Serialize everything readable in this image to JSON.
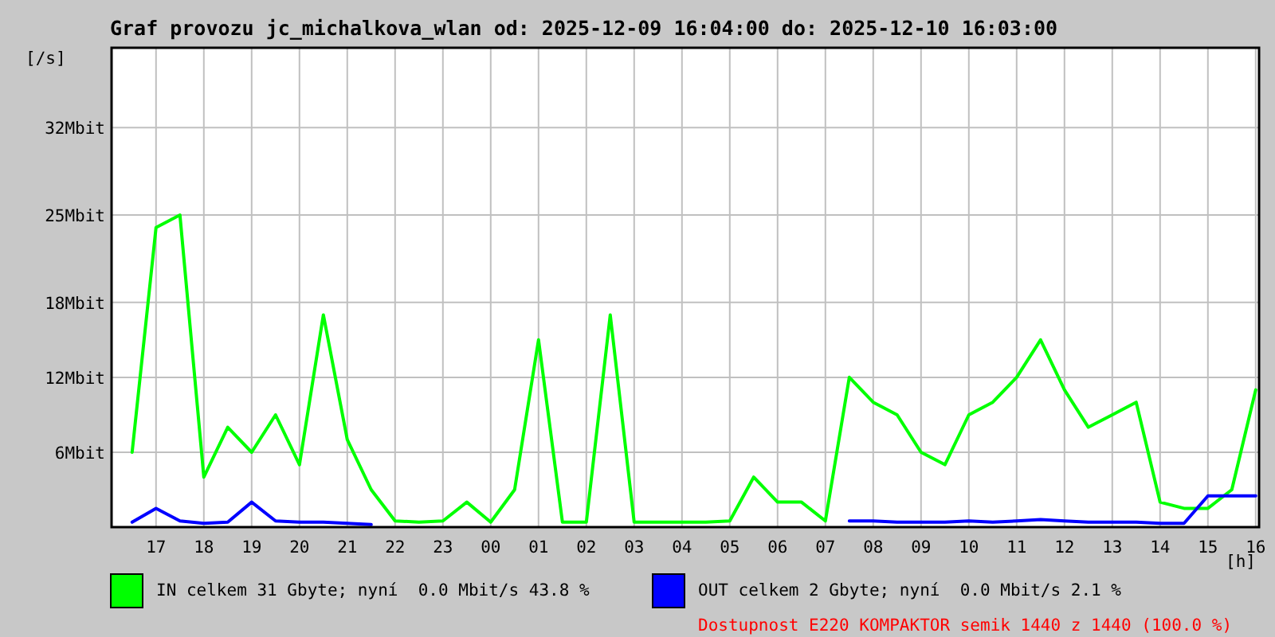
{
  "title": "Graf provozu jc_michalkova_wlan od: 2025-12-09 16:04:00 do: 2025-12-10 16:03:00",
  "chart_data": {
    "type": "line",
    "xlabel": "[h]",
    "grid": true,
    "ylabel": "[/s]",
    "ylim": [
      0,
      38.4
    ],
    "categories": [
      null,
      "17",
      null,
      "18",
      null,
      "19",
      null,
      "20",
      null,
      "21",
      null,
      "22",
      null,
      "23",
      null,
      "00",
      null,
      "01",
      null,
      "02",
      null,
      "03",
      null,
      "04",
      null,
      "05",
      null,
      "06",
      null,
      "07",
      null,
      "08",
      null,
      "09",
      null,
      "10",
      null,
      "11",
      null,
      "12",
      null,
      "13",
      null,
      "14",
      null,
      "15",
      null,
      "16"
    ],
    "yticks": [
      {
        "value": 6,
        "label": "6Mbit"
      },
      {
        "value": 12,
        "label": "12Mbit"
      },
      {
        "value": 18,
        "label": "18Mbit"
      },
      {
        "value": 25,
        "label": "25Mbit"
      },
      {
        "value": 32,
        "label": "32Mbit"
      }
    ],
    "series": [
      {
        "name": "IN",
        "color": "#00ff00",
        "values": [
          6,
          24,
          25,
          4,
          8,
          6,
          9,
          5,
          17,
          7,
          3,
          0.5,
          0.4,
          0.5,
          2,
          0.4,
          3,
          15,
          0.4,
          0.4,
          17,
          0.4,
          0.4,
          0.4,
          0.4,
          0.5,
          4,
          2,
          2,
          0.5,
          12,
          10,
          9,
          6,
          5,
          9,
          10,
          12,
          15,
          11,
          8,
          9,
          10,
          2,
          1.5,
          1.5,
          3,
          11
        ]
      },
      {
        "name": "OUT",
        "color": "#0000ff",
        "values": [
          0.4,
          1.5,
          0.5,
          0.3,
          0.4,
          2,
          0.5,
          0.4,
          0.4,
          0.3,
          0.2,
          null,
          null,
          null,
          null,
          null,
          null,
          null,
          null,
          null,
          null,
          null,
          null,
          null,
          null,
          null,
          null,
          null,
          null,
          null,
          0.5,
          0.5,
          0.4,
          0.4,
          0.4,
          0.5,
          0.4,
          0.5,
          0.6,
          0.5,
          0.4,
          0.4,
          0.4,
          0.3,
          0.3,
          2.5,
          2.5,
          2.5
        ]
      }
    ]
  },
  "legend": [
    {
      "text": "celkem 31 Gbyte; nyní  0.0 Mbit/s 43.8 %"
    },
    {
      "text": "celkem 2 Gbyte; nyní  0.0 Mbit/s 2.1 %",
      "note": "Dostupnost E220 KOMPAKTOR semik 1440 z 1440 (100.0 %)"
    }
  ]
}
